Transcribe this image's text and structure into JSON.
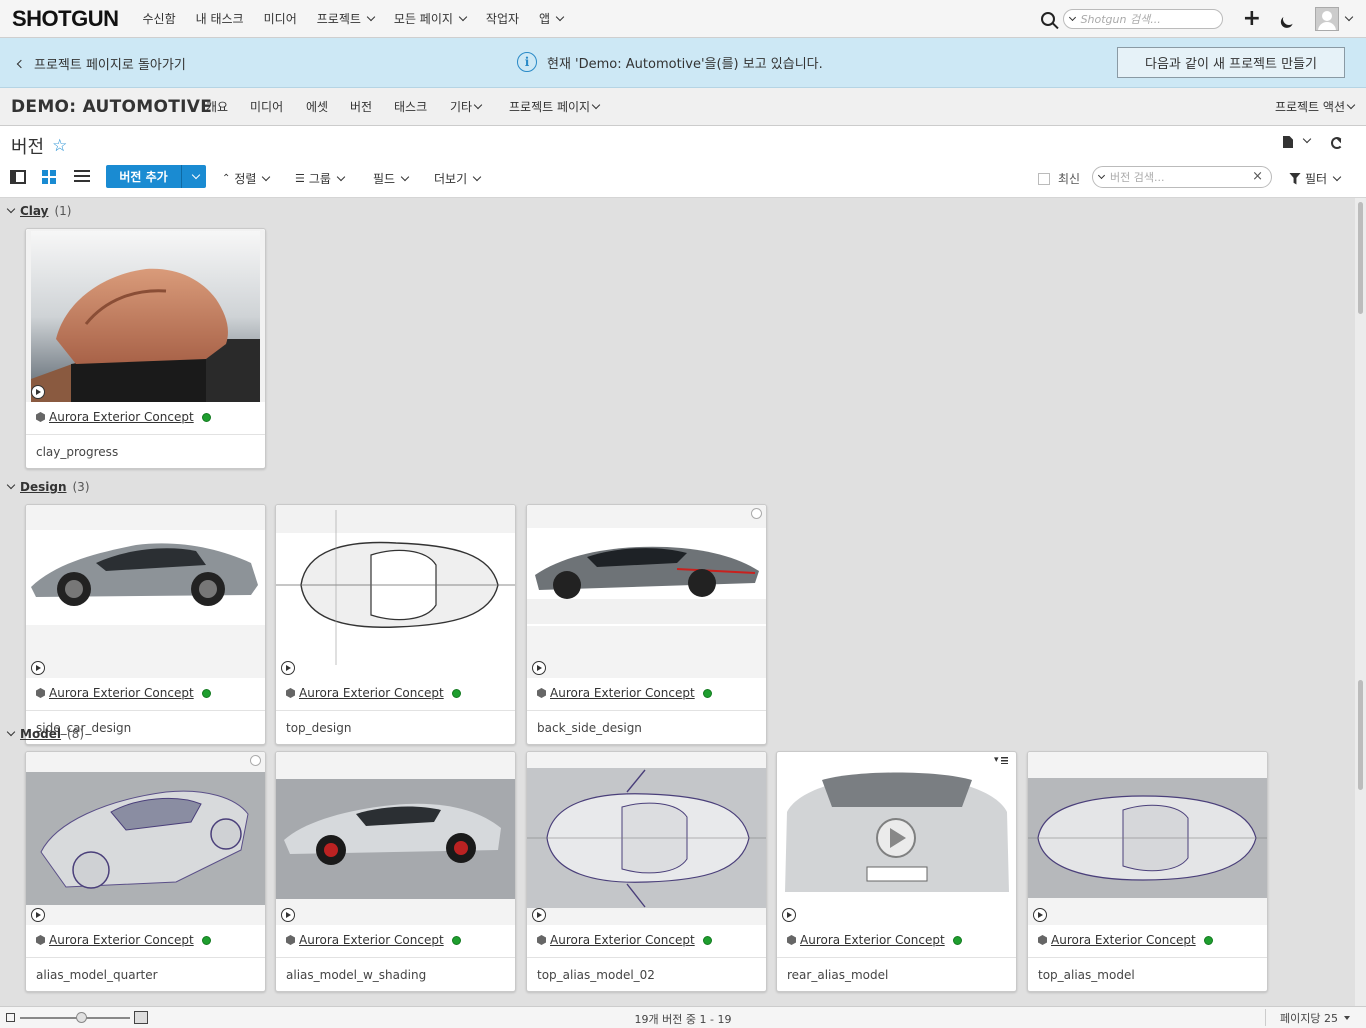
{
  "topnav": {
    "logo": "SHOTGUN",
    "links": [
      {
        "label": "수신함",
        "dropdown": false
      },
      {
        "label": "내 태스크",
        "dropdown": false
      },
      {
        "label": "미디어",
        "dropdown": false
      },
      {
        "label": "프로젝트",
        "dropdown": true
      },
      {
        "label": "모든 페이지",
        "dropdown": true
      },
      {
        "label": "작업자",
        "dropdown": false
      },
      {
        "label": "앱",
        "dropdown": true
      }
    ],
    "search_placeholder": "Shotgun 검색..."
  },
  "banner": {
    "back_label": "프로젝트 페이지로 돌아가기",
    "message": "현재 'Demo: Automotive'을(를) 보고 있습니다.",
    "new_project_label": "다음과 같이 새 프로젝트 만들기",
    "color": "#cde8f5"
  },
  "project_bar": {
    "title": "DEMO: AUTOMOTIVE",
    "tabs": [
      {
        "label": "개요",
        "dropdown": false
      },
      {
        "label": "미디어",
        "dropdown": false
      },
      {
        "label": "에셋",
        "dropdown": false
      },
      {
        "label": "버전",
        "dropdown": false,
        "active": true
      },
      {
        "label": "태스크",
        "dropdown": false
      },
      {
        "label": "기타",
        "dropdown": true
      },
      {
        "label": "프로젝트 페이지",
        "dropdown": true
      }
    ],
    "actions_label": "프로젝트 액션",
    "accent_color": "#1a8bd2"
  },
  "page": {
    "title": "버전",
    "toolbar": {
      "add_label": "버전 추가",
      "sort_label": "정렬",
      "group_label": "그룹",
      "fields_label": "필드",
      "more_label": "더보기",
      "latest_label": "최신",
      "search_placeholder": "버전 검색...",
      "filter_label": "필터"
    }
  },
  "groups": [
    {
      "name": "Clay",
      "count": "(1)",
      "cards": [
        {
          "entity": "Aurora Exterior Concept",
          "name": "clay_progress",
          "status_color": "#1e9e2e",
          "thumb": "clay"
        }
      ]
    },
    {
      "name": "Design",
      "count": "(3)",
      "cards": [
        {
          "entity": "Aurora Exterior Concept",
          "name": "side_car_design",
          "status_color": "#1e9e2e",
          "thumb": "side"
        },
        {
          "entity": "Aurora Exterior Concept",
          "name": "top_design",
          "status_color": "#1e9e2e",
          "thumb": "top"
        },
        {
          "entity": "Aurora Exterior Concept",
          "name": "back_side_design",
          "status_color": "#1e9e2e",
          "thumb": "back"
        }
      ]
    },
    {
      "name": "Model",
      "count": "(8)",
      "cards": [
        {
          "entity": "Aurora Exterior Concept",
          "name": "alias_model_quarter",
          "status_color": "#1e9e2e",
          "thumb": "quarter"
        },
        {
          "entity": "Aurora Exterior Concept",
          "name": "alias_model_w_shading",
          "status_color": "#1e9e2e",
          "thumb": "shading"
        },
        {
          "entity": "Aurora Exterior Concept",
          "name": "top_alias_model_02",
          "status_color": "#1e9e2e",
          "thumb": "topwire"
        },
        {
          "entity": "Aurora Exterior Concept",
          "name": "rear_alias_model",
          "status_color": "#1e9e2e",
          "thumb": "rear"
        },
        {
          "entity": "Aurora Exterior Concept",
          "name": "top_alias_model",
          "status_color": "#1e9e2e",
          "thumb": "topwire2"
        }
      ]
    }
  ],
  "footer": {
    "record_count": "19개 버전 중 1 - 19",
    "per_page_label": "페이지당 25"
  }
}
